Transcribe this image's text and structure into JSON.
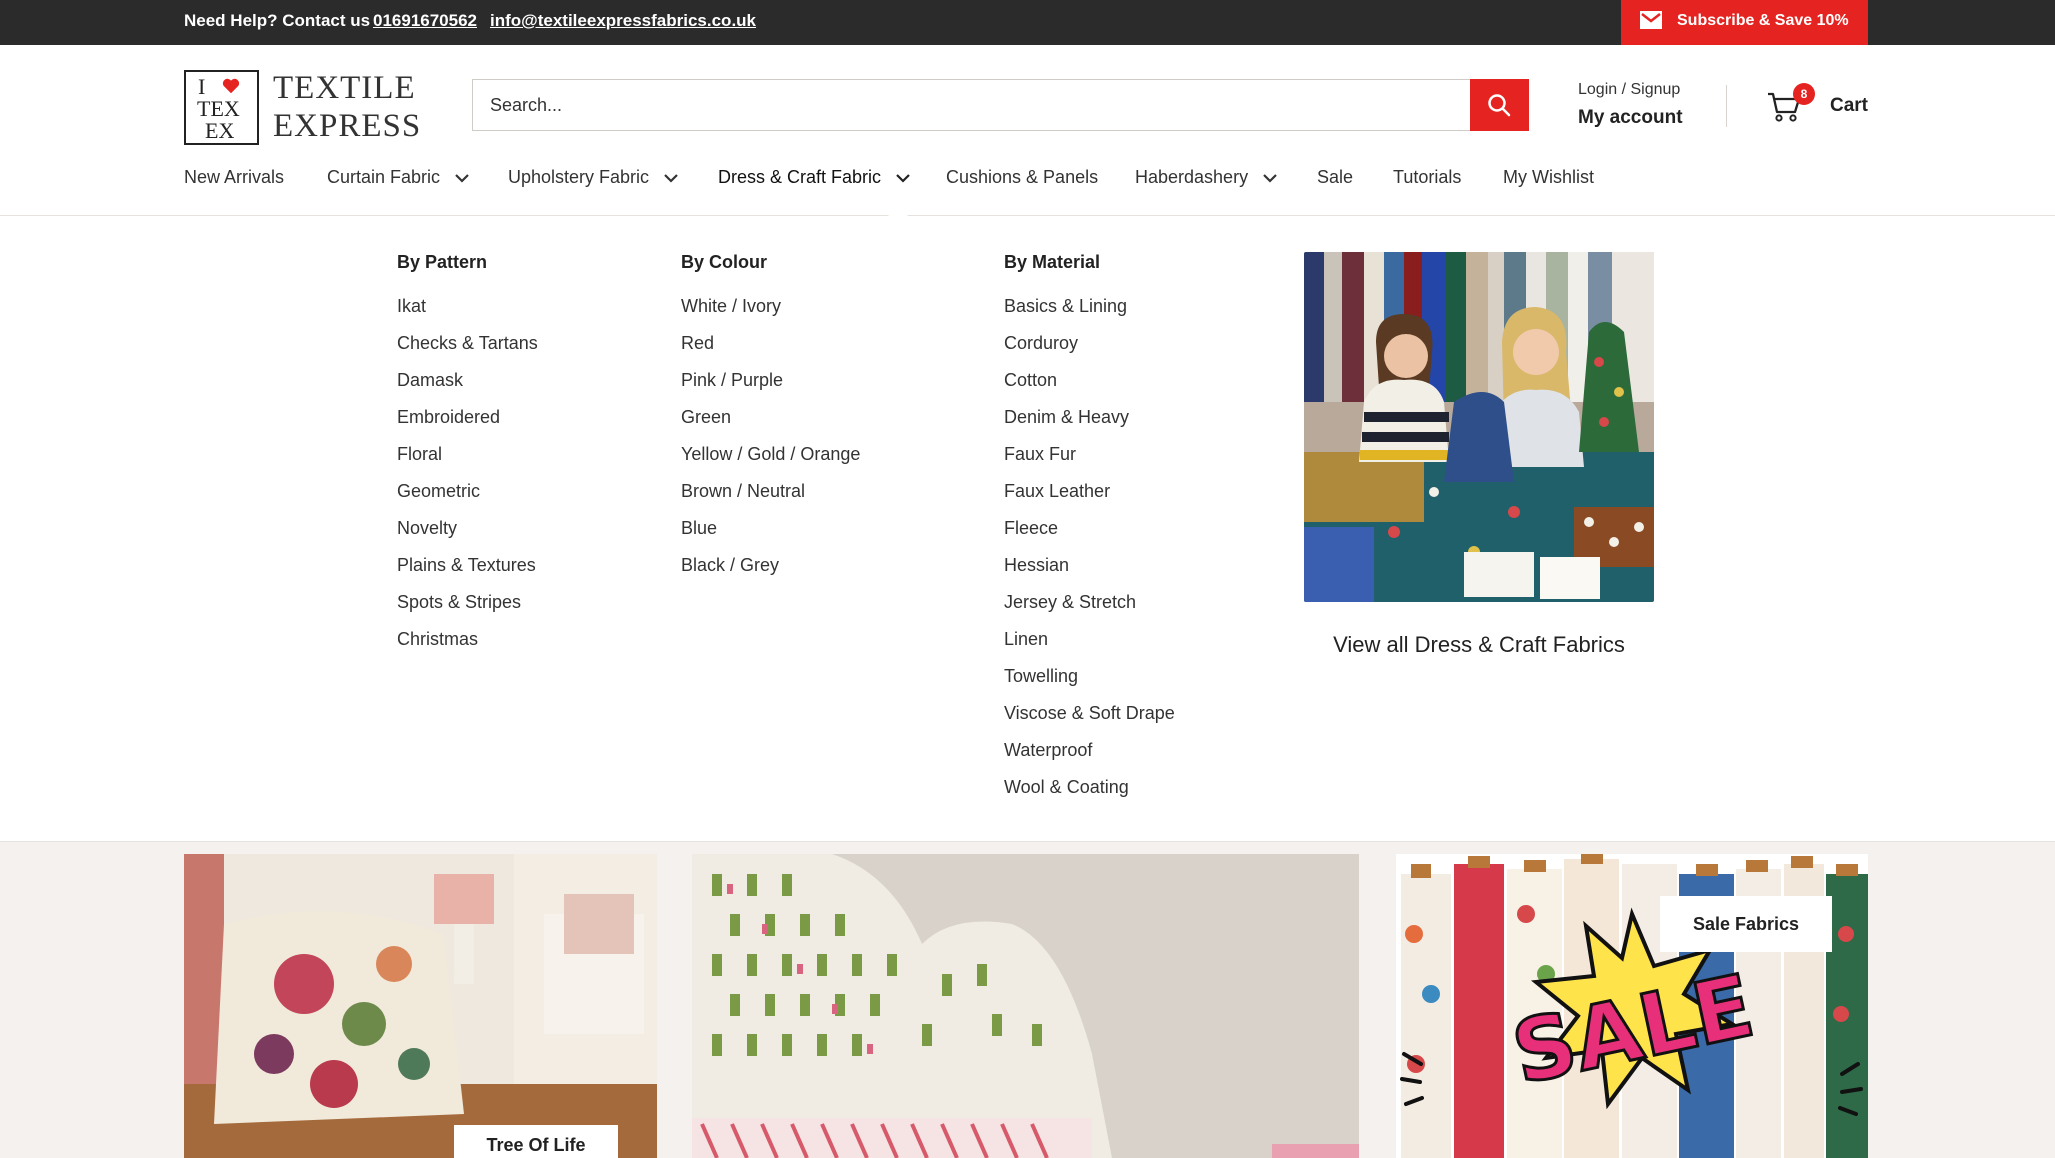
{
  "topbar": {
    "help_text": "Need Help? Contact us",
    "phone": "01691670562",
    "email": "info@textileexpressfabrics.co.uk",
    "subscribe_label": "Subscribe & Save 10%"
  },
  "logo": {
    "mark_line1": "I",
    "mark_line2": "TEX",
    "mark_line3": "EX",
    "name_line1": "TEXTILE",
    "name_line2": "EXPRESS"
  },
  "search": {
    "placeholder": "Search..."
  },
  "account": {
    "login_label": "Login / Signup",
    "account_label": "My account"
  },
  "cart": {
    "count": "8",
    "label": "Cart"
  },
  "nav": {
    "items": [
      {
        "label": "New Arrivals"
      },
      {
        "label": "Curtain Fabric"
      },
      {
        "label": "Upholstery Fabric"
      },
      {
        "label": "Dress & Craft Fabric"
      },
      {
        "label": "Cushions & Panels"
      },
      {
        "label": "Haberdashery"
      },
      {
        "label": "Sale"
      },
      {
        "label": "Tutorials"
      },
      {
        "label": "My Wishlist"
      }
    ]
  },
  "mega_menu": {
    "by_pattern": {
      "title": "By Pattern",
      "items": [
        "Ikat",
        "Checks & Tartans",
        "Damask",
        "Embroidered",
        "Floral",
        "Geometric",
        "Novelty",
        "Plains & Textures",
        "Spots & Stripes",
        "Christmas"
      ]
    },
    "by_colour": {
      "title": "By Colour",
      "items": [
        "White / Ivory",
        "Red",
        "Pink / Purple",
        "Green",
        "Yellow / Gold / Orange",
        "Brown / Neutral",
        "Blue",
        "Black / Grey"
      ]
    },
    "by_material": {
      "title": "By Material",
      "items": [
        "Basics & Lining",
        "Corduroy",
        "Cotton",
        "Denim & Heavy",
        "Faux Fur",
        "Faux Leather",
        "Fleece",
        "Hessian",
        "Jersey & Stretch",
        "Linen",
        "Towelling",
        "Viscose & Soft Drape",
        "Waterproof",
        "Wool & Coating"
      ]
    },
    "promo_link": "View all Dress & Craft Fabrics"
  },
  "tiles": {
    "tree_of_life": "Tree Of Life",
    "sale_fabrics": "Sale Fabrics",
    "sale_word": "SALE"
  },
  "colors": {
    "accent": "#e52421",
    "topbar": "#2b2b2b"
  }
}
